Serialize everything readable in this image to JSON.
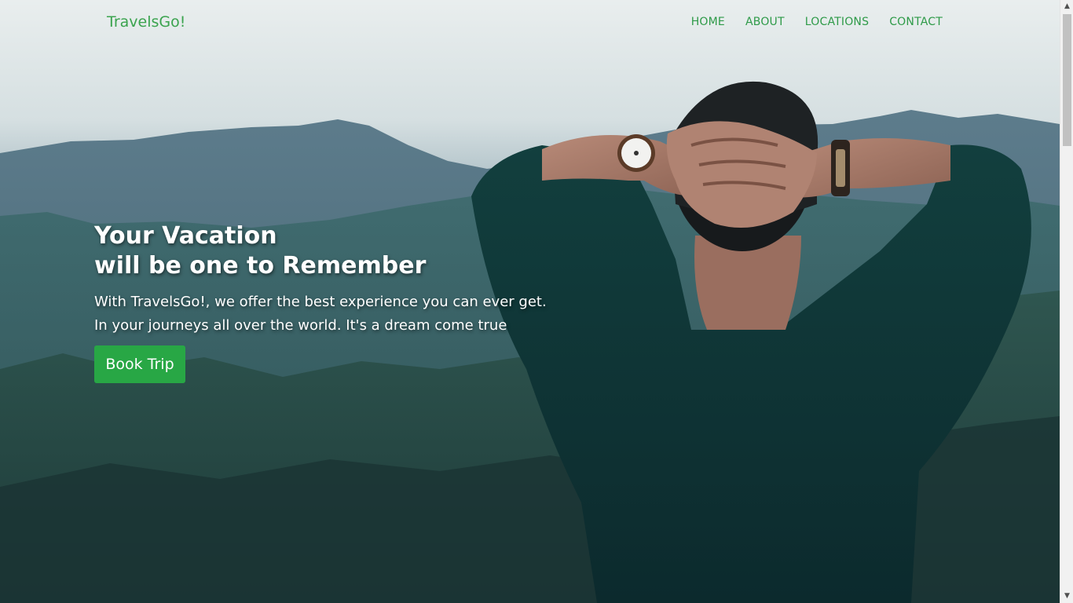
{
  "nav": {
    "brand": "TravelsGo!",
    "links": [
      "HOME",
      "ABOUT",
      "LOCATIONS",
      "CONTACT"
    ]
  },
  "hero": {
    "title_line1": "Your Vacation",
    "title_line2": "will be one to Remember",
    "desc_line1": "With TravelsGo!, we offer the best experience you can ever get.",
    "desc_line2": "In your journeys all over the world. It's a dream come true",
    "button_label": "Book Trip"
  },
  "colors": {
    "accent": "#28a745",
    "nav_text": "#2e9a48"
  },
  "scrollbar": {
    "up_icon": "triangle-up-icon",
    "down_icon": "triangle-down-icon"
  }
}
